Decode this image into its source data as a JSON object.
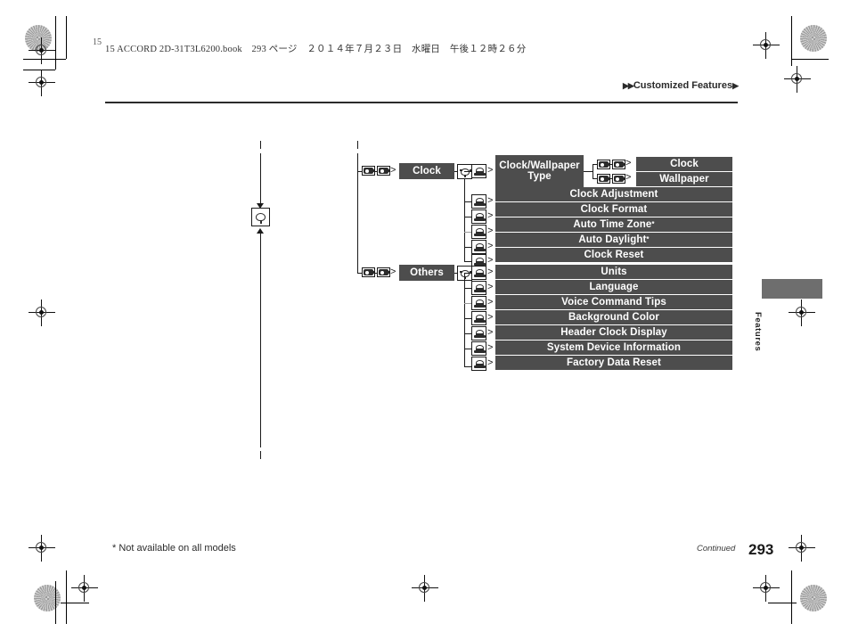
{
  "print": {
    "book_line": "15 ACCORD 2D-31T3L6200.book　293 ページ　２０１４年７月２３日　水曜日　午後１２時２６分",
    "sheet_number": "15"
  },
  "header": {
    "running_head": "Customized Features",
    "triangle_left": "▶▶",
    "triangle_right": "▶"
  },
  "side_tab": {
    "label": "Features"
  },
  "footer": {
    "footnote": "* Not available on all models",
    "continued": "Continued",
    "page_number": "293"
  },
  "icons": {
    "knob": "rotary-knob-icon",
    "push": "push-knob-icon",
    "button": "preset-button-icon",
    "arrow": "arrow-head-icon"
  },
  "colors": {
    "bar_fill": "#4d4d4d",
    "bar_text": "#ffffff",
    "rule": "#2b2b2b",
    "tab": "#6e6e6e"
  },
  "chart_data": {
    "type": "diagram",
    "title": "Customized Features menu tree",
    "menus": [
      {
        "name": "Clock",
        "items": [
          {
            "label": "Clock/Wallpaper Type",
            "options": [
              "Clock",
              "Wallpaper"
            ],
            "footnote": false
          },
          {
            "label": "Clock Adjustment",
            "options": [],
            "footnote": false
          },
          {
            "label": "Clock Format",
            "options": [],
            "footnote": false
          },
          {
            "label": "Auto Time Zone",
            "options": [],
            "footnote": true
          },
          {
            "label": "Auto Daylight",
            "options": [],
            "footnote": true
          },
          {
            "label": "Clock Reset",
            "options": [],
            "footnote": false
          }
        ]
      },
      {
        "name": "Others",
        "items": [
          {
            "label": "Units",
            "options": [],
            "footnote": false
          },
          {
            "label": "Language",
            "options": [],
            "footnote": false
          },
          {
            "label": "Voice Command Tips",
            "options": [],
            "footnote": false
          },
          {
            "label": "Background Color",
            "options": [],
            "footnote": false
          },
          {
            "label": "Header Clock Display",
            "options": [],
            "footnote": false
          },
          {
            "label": "System Device Information",
            "options": [],
            "footnote": false
          },
          {
            "label": "Factory Data Reset",
            "options": [],
            "footnote": false
          }
        ]
      }
    ],
    "sub_options": [
      "Clock",
      "Wallpaper"
    ],
    "footnote_marker": "*"
  }
}
